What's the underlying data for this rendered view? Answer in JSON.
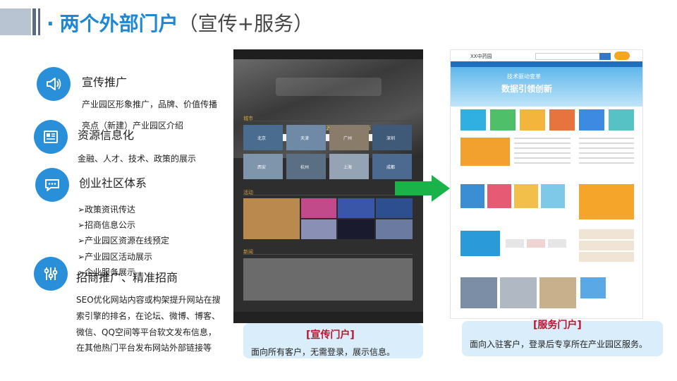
{
  "title": {
    "dot": "·",
    "main": "两个外部门户",
    "paren": "（宣传+服务）"
  },
  "sections": [
    {
      "title": "宣传推广",
      "lines": [
        "产业园区形象推广，品牌、价值传播",
        "亮点（新建）产业园区介绍"
      ]
    },
    {
      "title": "资源信息化",
      "lines": [
        "金融、人才、技术、政策的展示"
      ]
    },
    {
      "title": "创业社区体系",
      "lines": [
        "➢政策资讯传达",
        "➢招商信息公示",
        "➢产业园区资源在线预定",
        "➢产业园区活动展示",
        "➢企业服务展示"
      ]
    },
    {
      "title": "招商推广、精准招商",
      "lines": [
        "SEO优化网站内容或构架提升网站在搜",
        "索引擎的排名，在论坛、微博、博客、",
        "微信、QQ空间等平台软文发布信息，",
        "在其他热门平台发布网站外部链接等"
      ]
    }
  ],
  "screenshot1": {
    "banner_text": "整合创新创业资源　塑造社区生态",
    "sections": [
      "城市",
      "活动",
      "新闻"
    ],
    "cities": [
      "北京",
      "天津",
      "广州",
      "深圳",
      "西安",
      "杭州",
      "上海",
      "成都"
    ]
  },
  "screenshot2": {
    "logo": "XX中药园",
    "banner_line1": "技术驱动变革",
    "banner_line2": "数据引领创新"
  },
  "captions": [
    {
      "title": "[宣传门户]",
      "text": "面向所有客户，无需登录，展示信息。"
    },
    {
      "title": "[服务门户]",
      "text": "面向入驻客户，登录后专享所在产业园区服务。"
    }
  ],
  "colors": {
    "accent": "#1e88d6",
    "icon_bg": "#2a8fd9",
    "arrow": "#19b34a",
    "caption_bg": "#d9eefa",
    "caption_title": "#c0102b"
  }
}
